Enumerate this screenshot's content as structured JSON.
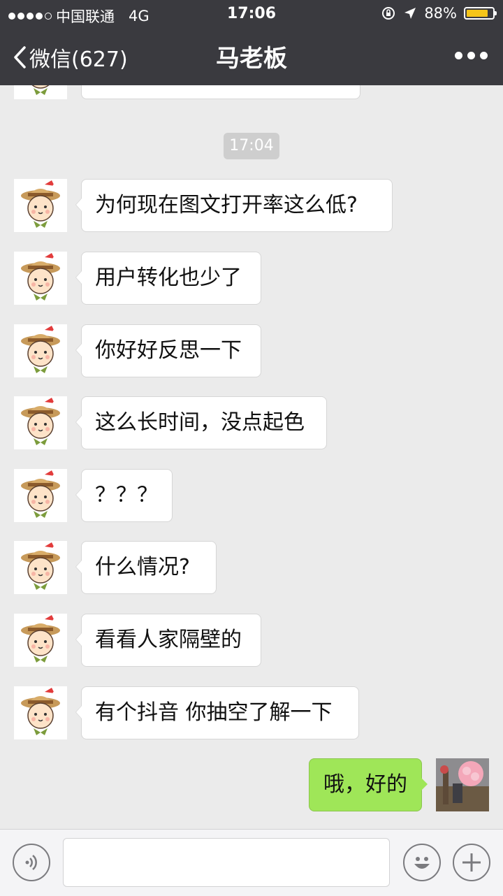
{
  "status_bar": {
    "carrier": "中国联通",
    "network": "4G",
    "time": "17:06",
    "battery": "88%",
    "battery_level": 0.88
  },
  "nav": {
    "back_label": "微信(627)",
    "title": "马老板"
  },
  "chat": {
    "timestamp": "17:04",
    "messages": [
      {
        "from": "other",
        "text": "为何现在图文打开率这么低?"
      },
      {
        "from": "other",
        "text": "用户转化也少了"
      },
      {
        "from": "other",
        "text": "你好好反思一下"
      },
      {
        "from": "other",
        "text": "这么长时间，没点起色"
      },
      {
        "from": "other",
        "text": "？？？"
      },
      {
        "from": "other",
        "text": "什么情况?"
      },
      {
        "from": "other",
        "text": "看看人家隔壁的"
      },
      {
        "from": "other",
        "text": "有个抖音  你抽空了解一下"
      },
      {
        "from": "me",
        "text": "哦，好的"
      }
    ]
  },
  "input": {
    "value": "",
    "placeholder": ""
  },
  "colors": {
    "nav_bg": "#3a3a3f",
    "chat_bg": "#ebebeb",
    "my_bubble": "#9fe658",
    "battery_fill": "#f5c519"
  },
  "icons": [
    "signal-dots-icon",
    "orientation-lock-icon",
    "location-arrow-icon",
    "battery-icon",
    "back-chevron-icon",
    "more-icon",
    "voice-icon",
    "emoji-icon",
    "plus-icon"
  ]
}
